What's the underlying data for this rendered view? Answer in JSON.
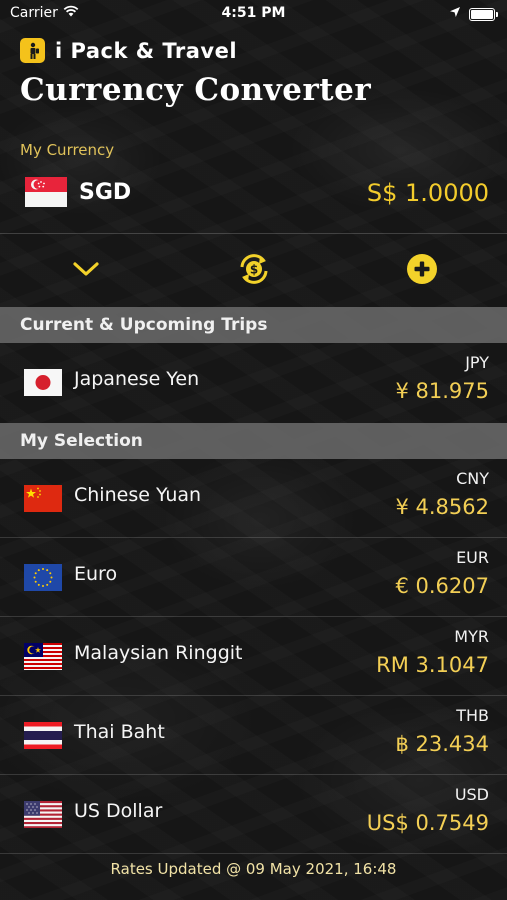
{
  "status_bar": {
    "carrier": "Carrier",
    "time": "4:51 PM"
  },
  "header": {
    "app_name": "i Pack & Travel",
    "title": "Currency Converter"
  },
  "my_currency": {
    "label": "My Currency",
    "code": "SGD",
    "value": "S$ 1.0000",
    "flag_icon": "singapore-flag-icon"
  },
  "actions": [
    {
      "name": "collapse-button",
      "icon": "chevron-down-icon"
    },
    {
      "name": "refresh-rates-button",
      "icon": "currency-refresh-icon"
    },
    {
      "name": "add-currency-button",
      "icon": "plus-circle-icon"
    }
  ],
  "sections": {
    "trips": {
      "title": "Current & Upcoming Trips",
      "items": [
        {
          "name": "Japanese Yen",
          "code": "JPY",
          "value": "¥ 81.975",
          "flag_icon": "japan-flag-icon"
        }
      ]
    },
    "selection": {
      "title": "My Selection",
      "items": [
        {
          "name": "Chinese Yuan",
          "code": "CNY",
          "value": "¥ 4.8562",
          "flag_icon": "china-flag-icon"
        },
        {
          "name": "Euro",
          "code": "EUR",
          "value": "€ 0.6207",
          "flag_icon": "eu-flag-icon"
        },
        {
          "name": "Malaysian Ringgit",
          "code": "MYR",
          "value": "RM 3.1047",
          "flag_icon": "malaysia-flag-icon"
        },
        {
          "name": "Thai Baht",
          "code": "THB",
          "value": "฿ 23.434",
          "flag_icon": "thailand-flag-icon"
        },
        {
          "name": "US Dollar",
          "code": "USD",
          "value": "US$ 0.7549",
          "flag_icon": "usa-flag-icon"
        }
      ]
    }
  },
  "footer": {
    "rates_updated": "Rates Updated @ 09 May 2021, 16:48"
  },
  "colors": {
    "accent_yellow": "#f3cc2c",
    "value_yellow": "#f3cf55",
    "section_header_bg": "#696969",
    "background": "#161616"
  }
}
